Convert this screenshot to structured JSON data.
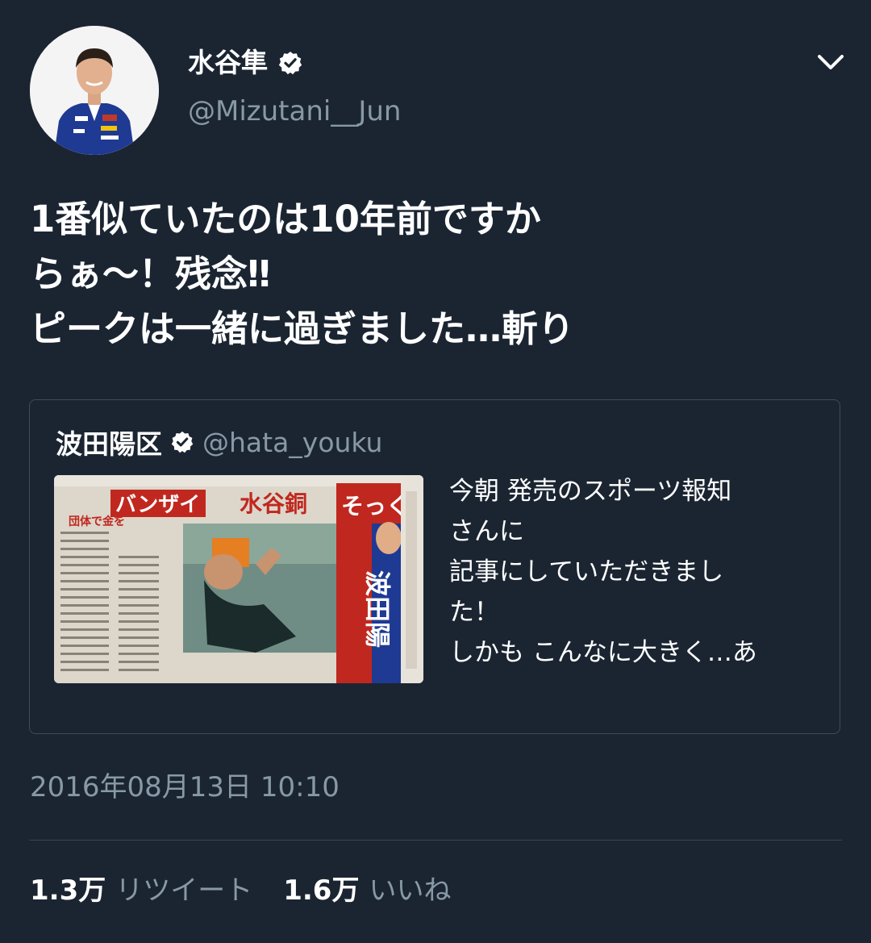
{
  "author": {
    "display_name": "水谷隼",
    "handle": "@Mizutani__Jun",
    "verified_icon": "verified-badge-icon"
  },
  "tweet": {
    "lines": [
      "1番似ていたのは10年前ですか",
      "らぁ〜！残念‼",
      "ピークは一緒に過ぎました…斬り"
    ]
  },
  "quoted_tweet": {
    "display_name": "波田陽区",
    "handle": "@hata_youku",
    "lines": [
      "今朝 発売のスポーツ報知",
      "さんに",
      "記事にしていただきまし",
      "た！",
      "しかも こんなに大きく…あ"
    ],
    "image_headlines": {
      "left": "バンザイ",
      "center": "水谷銅",
      "right_top": "そっくり",
      "right_name": "波田陽",
      "sub": "団体で金を"
    }
  },
  "timestamp": "2016年08月13日 10:10",
  "stats": {
    "retweets_count": "1.3万",
    "retweets_label": "リツイート",
    "likes_count": "1.6万",
    "likes_label": "いいね"
  },
  "colors": {
    "background": "#1b2532",
    "secondary_text": "#8899a6",
    "border": "#3d4b5b",
    "verified_badge": "#ffffff"
  }
}
